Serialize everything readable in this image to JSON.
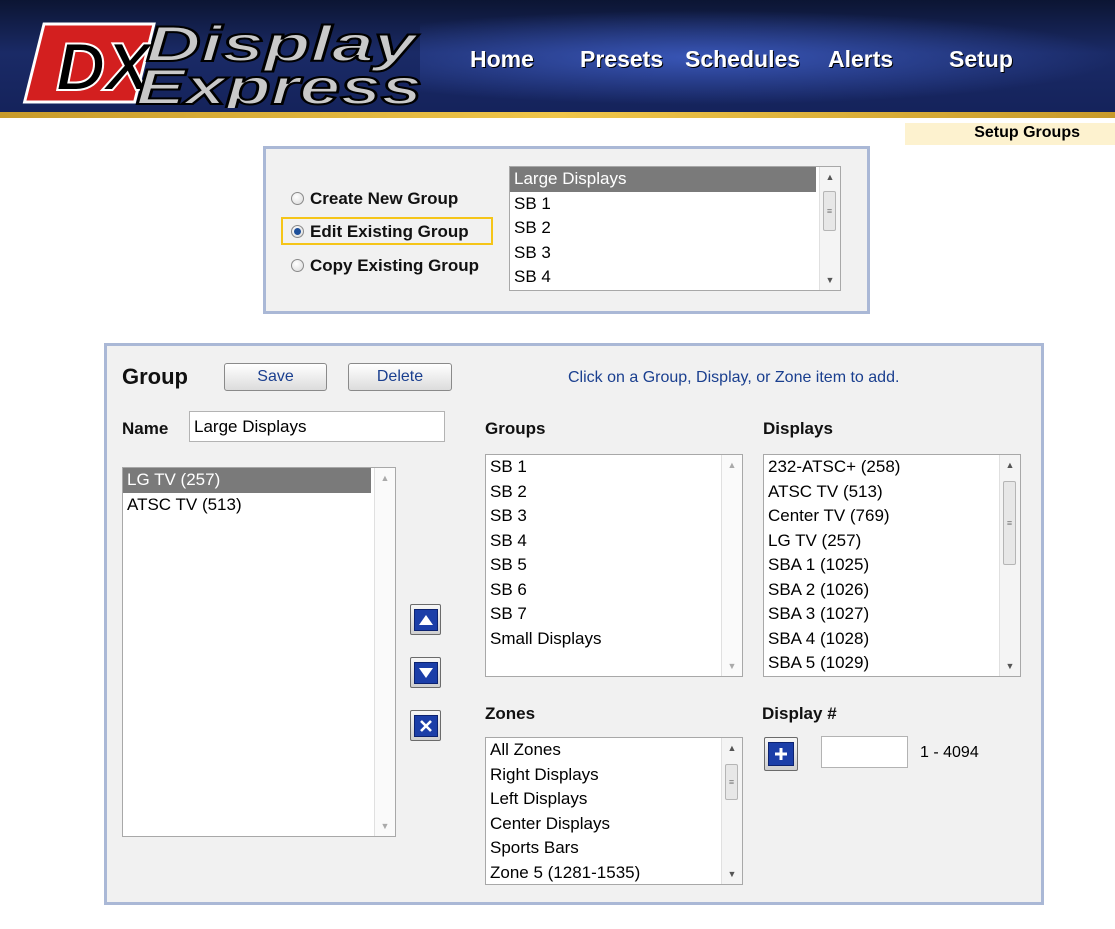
{
  "header": {
    "logo_mark": "DX",
    "logo_line1": "Display",
    "logo_line2": "Express",
    "nav": [
      "Home",
      "Presets",
      "Schedules",
      "Alerts",
      "Setup"
    ]
  },
  "page_subtitle": "Setup Groups",
  "mode_panel": {
    "options": [
      "Create New Group",
      "Edit Existing Group",
      "Copy Existing Group"
    ],
    "selected_option": "Edit Existing Group",
    "groups_list": [
      "Large Displays",
      "SB 1",
      "SB 2",
      "SB 3",
      "SB 4"
    ],
    "groups_selected": "Large Displays"
  },
  "group_panel": {
    "title": "Group",
    "save_label": "Save",
    "delete_label": "Delete",
    "hint": "Click on a Group, Display, or Zone item to add.",
    "name_label": "Name",
    "name_value": "Large Displays",
    "members": [
      "LG TV (257)",
      "ATSC TV (513)"
    ],
    "members_selected": "LG TV (257)",
    "groups_label": "Groups",
    "groups": [
      "SB 1",
      "SB 2",
      "SB 3",
      "SB 4",
      "SB 5",
      "SB 6",
      "SB 7",
      "Small Displays"
    ],
    "displays_label": "Displays",
    "displays": [
      "232-ATSC+ (258)",
      "ATSC TV (513)",
      "Center TV (769)",
      "LG TV (257)",
      "SBA 1 (1025)",
      "SBA 2 (1026)",
      "SBA 3 (1027)",
      "SBA 4 (1028)",
      "SBA 5 (1029)"
    ],
    "zones_label": "Zones",
    "zones": [
      "All Zones",
      "Right Displays",
      "Left Displays",
      "Center Displays",
      "Sports Bars",
      "Zone 5 (1281-1535)"
    ],
    "display_num_label": "Display #",
    "display_num_value": "",
    "display_num_range": "1 - 4094"
  },
  "colors": {
    "accent_blue": "#1b3ea8",
    "panel_border": "#aab8d6",
    "highlight": "#f5c518",
    "logo_red": "#d31f1f"
  },
  "icons": [
    "move-up-icon",
    "move-down-icon",
    "remove-icon",
    "add-icon",
    "scroll-up-icon",
    "scroll-down-icon"
  ]
}
